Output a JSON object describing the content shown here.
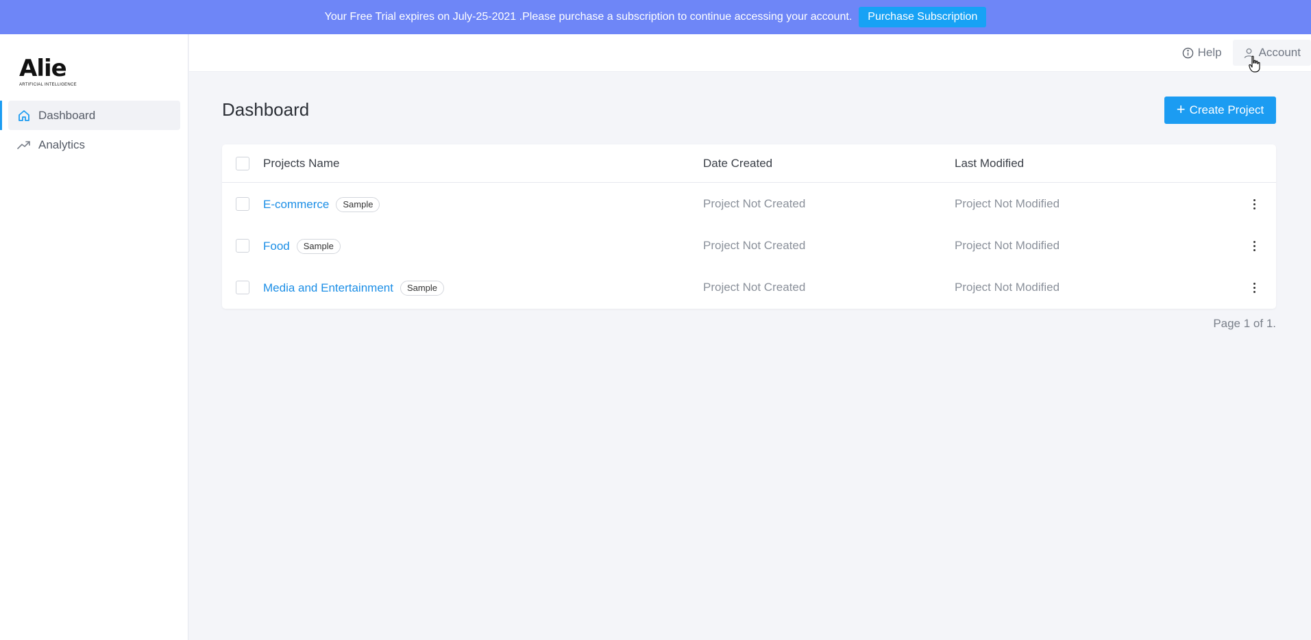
{
  "banner": {
    "text": "Your Free Trial expires on July-25-2021 .Please purchase a subscription to continue accessing your account.",
    "button_label": "Purchase Subscription"
  },
  "brand": {
    "name": "Alie",
    "tagline": "ARTIFICIAL INTELLIGENCE"
  },
  "sidebar": {
    "items": [
      {
        "label": "Dashboard",
        "icon": "home-icon",
        "active": true
      },
      {
        "label": "Analytics",
        "icon": "trending-up-icon",
        "active": false
      }
    ]
  },
  "header": {
    "help_label": "Help",
    "account_label": "Account"
  },
  "main": {
    "title": "Dashboard",
    "create_label": "Create Project",
    "table": {
      "columns": [
        "Projects Name",
        "Date Created",
        "Last Modified"
      ],
      "rows": [
        {
          "name": "E-commerce",
          "tag": "Sample",
          "date_created": "Project Not Created",
          "last_modified": "Project Not Modified"
        },
        {
          "name": "Food",
          "tag": "Sample",
          "date_created": "Project Not Created",
          "last_modified": "Project Not Modified"
        },
        {
          "name": "Media and Entertainment",
          "tag": "Sample",
          "date_created": "Project Not Created",
          "last_modified": "Project Not Modified"
        }
      ]
    },
    "pagination": "Page 1 of 1."
  },
  "colors": {
    "banner": "#6e86f7",
    "primary": "#1b9cf2",
    "link": "#1b8ee6",
    "background": "#f4f5f9"
  }
}
